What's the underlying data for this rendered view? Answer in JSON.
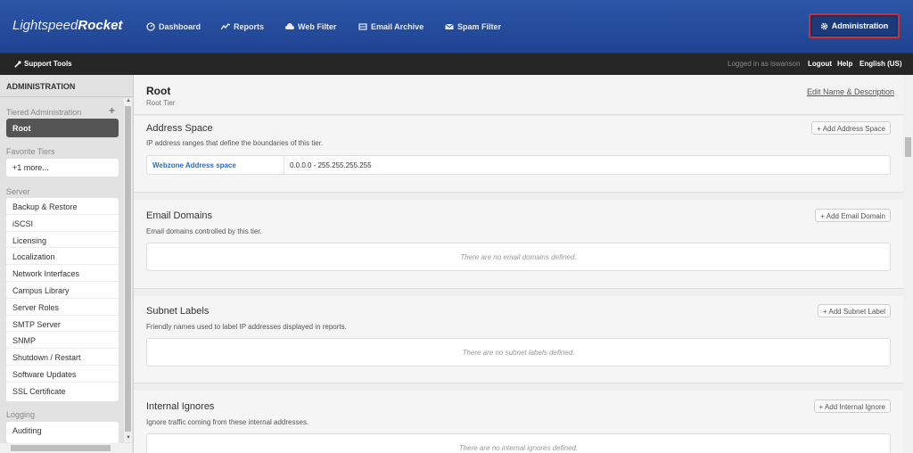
{
  "brand": {
    "name_light": "Lightspeed",
    "name_bold": "Rocket"
  },
  "nav": {
    "items": [
      {
        "label": "Dashboard",
        "icon": "gauge-icon"
      },
      {
        "label": "Reports",
        "icon": "chart-line-icon"
      },
      {
        "label": "Web Filter",
        "icon": "cloud-icon"
      },
      {
        "label": "Email Archive",
        "icon": "inbox-icon"
      },
      {
        "label": "Spam Filter",
        "icon": "envelope-icon"
      }
    ],
    "admin_label": "Administration",
    "admin_icon": "gear-icon",
    "active_border_color": "#d0312d"
  },
  "subbar": {
    "support_label": "Support Tools",
    "logged_in": "Logged in as iswanson",
    "logout": "Logout",
    "help": "Help",
    "language": "English (US)"
  },
  "sidebar": {
    "title": "ADMINISTRATION",
    "tiered_label": "Tiered Administration",
    "root_item": "Root",
    "favorite_label": "Favorite Tiers",
    "favorite_item": "+1 more...",
    "server_label": "Server",
    "server_items": [
      "Backup & Restore",
      "iSCSI",
      "Licensing",
      "Localization",
      "Network Interfaces",
      "Campus Library",
      "Server Roles",
      "SMTP Server",
      "SNMP",
      "Shutdown / Restart",
      "Software Updates",
      "SSL Certificate"
    ],
    "logging_label": "Logging",
    "logging_items": [
      "Auditing"
    ]
  },
  "main": {
    "title": "Root",
    "subtitle": "Root Tier",
    "edit_link": "Edit Name & Description",
    "sections": {
      "address": {
        "title": "Address Space",
        "desc": "IP address ranges that define the boundaries of this tier.",
        "button": "+ Add Address Space",
        "row_name": "Webzone Address space",
        "row_range": "0.0.0.0 - 255.255.255.255"
      },
      "email": {
        "title": "Email Domains",
        "desc": "Email domains controlled by this tier.",
        "button": "+ Add Email Domain",
        "empty": "There are no email domains defined."
      },
      "subnet": {
        "title": "Subnet Labels",
        "desc": "Friendly names used to label IP addresses displayed in reports.",
        "button": "+ Add Subnet Label",
        "empty": "There are no subnet labels defined."
      },
      "ignores": {
        "title": "Internal Ignores",
        "desc": "Ignore traffic coming from these internal addresses.",
        "button": "+ Add Internal Ignore",
        "empty": "There are no internal ignores defined."
      }
    }
  }
}
